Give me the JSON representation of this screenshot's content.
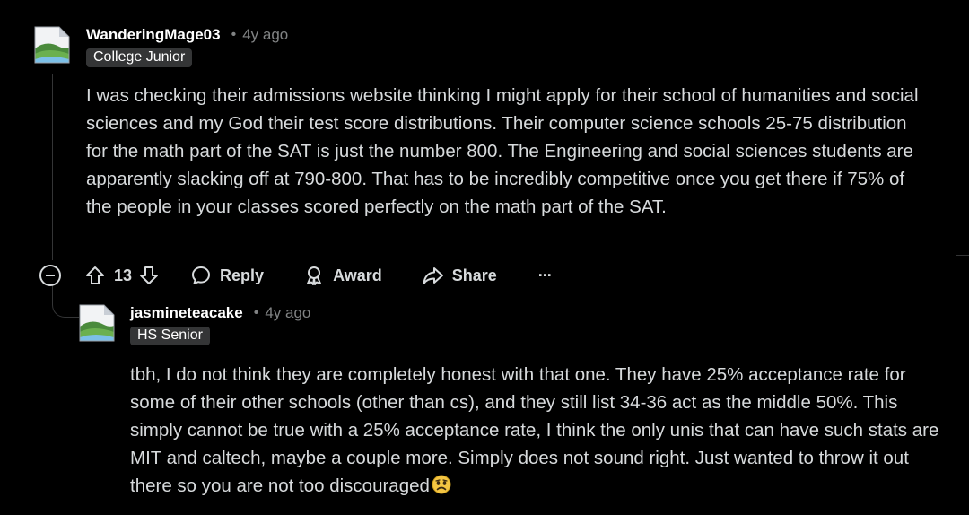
{
  "comment": {
    "author": "WanderingMage03",
    "time": "4y ago",
    "flair": "College Junior",
    "body": "I was checking their admissions website thinking I might apply for their school of humanities and social sciences and my God their test score distributions. Their computer science schools 25-75 distribution for the math part of the SAT is just the number 800. The Engineering and social sciences students are apparently slacking off at 790-800. That has to be incredibly competitive once you get there if 75% of the people in your classes scored perfectly on the math part of the SAT.",
    "vote_count": "13",
    "actions": {
      "reply": "Reply",
      "award": "Award",
      "share": "Share",
      "more": "···"
    }
  },
  "reply": {
    "author": "jasmineteacake",
    "time": "4y ago",
    "flair": "HS Senior",
    "body": "tbh, I do not think they are completely honest with that one. They have 25% acceptance rate for some of their other schools (other than cs), and they still list 34-36 act as the middle 50%. This simply cannot be true with a 25% acceptance rate, I think the only unis that can have such stats are MIT and caltech, maybe a couple more. Simply does not sound right. Just wanted to throw it out there so you are not too discouraged",
    "emoji": "frowning-face-emoji"
  },
  "separator": "•",
  "colors": {
    "background": "#000000",
    "text": "#d7dadc",
    "muted": "#818384",
    "flair_bg": "#343536"
  }
}
